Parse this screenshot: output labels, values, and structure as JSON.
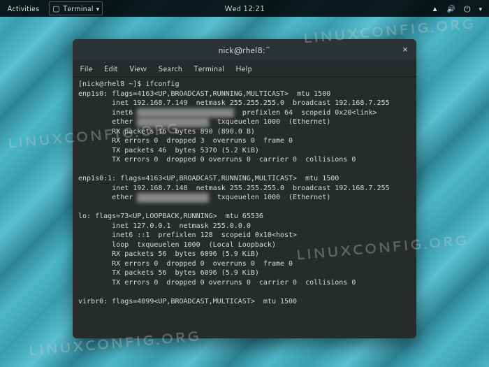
{
  "top_panel": {
    "activities": "Activities",
    "terminal_label": "Terminal",
    "clock": "Wed 12:21"
  },
  "window": {
    "title": "nick@rhel8:~",
    "close": "×"
  },
  "menubar": {
    "file": "File",
    "edit": "Edit",
    "view": "View",
    "search": "Search",
    "terminal": "Terminal",
    "help": "Help"
  },
  "terminal": {
    "prompt": "[nick@rhel8 ~]$ ",
    "command": "ifconfig",
    "output": {
      "enp1s0_line1": "enp1s0: flags=4163<UP,BROADCAST,RUNNING,MULTICAST>  mtu 1500",
      "enp1s0_inet": "        inet 192.168.7.149  netmask 255.255.255.0  broadcast 192.168.7.255",
      "enp1s0_inet6_a": "        inet6 ",
      "enp1s0_inet6_hidden": "xxxx::xxxx:xx:xxxx:xxxx",
      "enp1s0_inet6_b": "  prefixlen 64  scopeid 0x20<link>",
      "enp1s0_ether_a": "        ether ",
      "enp1s0_ether_hidden": "xx:xx:xx:xx:xx:xx",
      "enp1s0_ether_b": "  txqueuelen 1000  (Ethernet)",
      "enp1s0_rx1": "        RX packets 16  bytes 890 (890.0 B)",
      "enp1s0_rx2": "        RX errors 0  dropped 3  overruns 0  frame 0",
      "enp1s0_tx1": "        TX packets 46  bytes 5370 (5.2 KiB)",
      "enp1s0_tx2": "        TX errors 0  dropped 0 overruns 0  carrier 0  collisions 0",
      "enp1s0_1_line1": "enp1s0:1: flags=4163<UP,BROADCAST,RUNNING,MULTICAST>  mtu 1500",
      "enp1s0_1_inet": "        inet 192.168.7.148  netmask 255.255.255.0  broadcast 192.168.7.255",
      "enp1s0_1_ether_a": "        ether ",
      "enp1s0_1_ether_hidden": "xx:xx:xx:xx:xx:xx",
      "enp1s0_1_ether_b": "  txqueuelen 1000  (Ethernet)",
      "lo_line1": "lo: flags=73<UP,LOOPBACK,RUNNING>  mtu 65536",
      "lo_inet": "        inet 127.0.0.1  netmask 255.0.0.0",
      "lo_inet6": "        inet6 ::1  prefixlen 128  scopeid 0x10<host>",
      "lo_loop": "        loop  txqueuelen 1000  (Local Loopback)",
      "lo_rx1": "        RX packets 56  bytes 6096 (5.9 KiB)",
      "lo_rx2": "        RX errors 0  dropped 0  overruns 0  frame 0",
      "lo_tx1": "        TX packets 56  bytes 6096 (5.9 KiB)",
      "lo_tx2": "        TX errors 0  dropped 0 overruns 0  carrier 0  collisions 0",
      "virbr0_line1": "virbr0: flags=4099<UP,BROADCAST,MULTICAST>  mtu 1500"
    }
  },
  "watermark": "LINUXCONFIG.ORG"
}
